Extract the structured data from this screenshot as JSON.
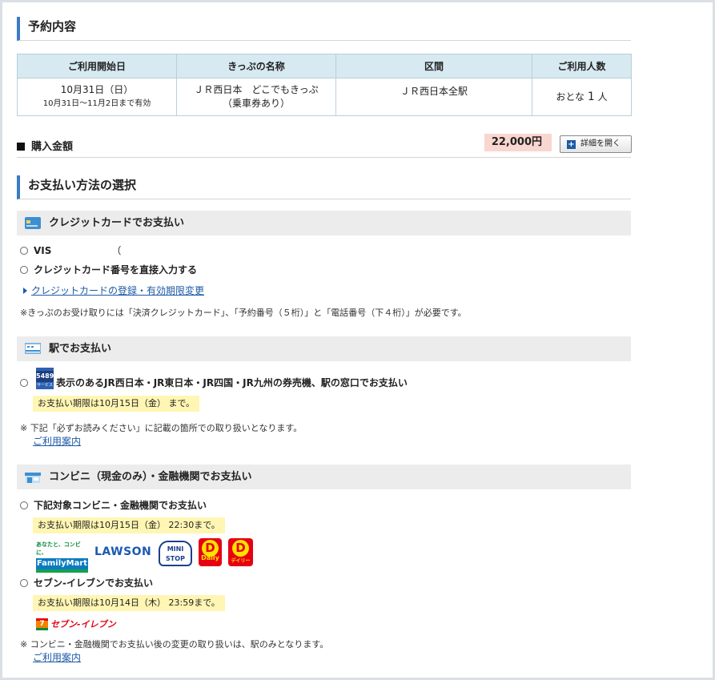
{
  "reservation": {
    "title": "予約内容",
    "headers": [
      "ご利用開始日",
      "きっぷの名称",
      "区間",
      "ご利用人数"
    ],
    "row": {
      "date": "10月31日（日）",
      "date_range": "10月31日～11月2日まで有効",
      "ticket_name": "ＪＲ西日本　どこでもきっぷ",
      "ticket_sub": "（乗車券あり）",
      "section": "ＪＲ西日本全駅",
      "people_prefix": "おとな",
      "people_count": "1",
      "people_suffix": "人"
    }
  },
  "purchase": {
    "label": "購入金額",
    "price": "22,000円",
    "detail_button": "詳細を開く",
    "detail_icon": "+"
  },
  "payment": {
    "title": "お支払い方法の選択",
    "credit": {
      "band": "クレジットカードでお支払い",
      "option1": "VIS",
      "option1_tail": "（",
      "option2": "クレジットカード番号を直接入力する",
      "link": "クレジットカードの登録・有効期限変更",
      "note": "※きっぷのお受け取りには「決済クレジットカード」、「予約番号（５桁）」と「電話番号（下４桁）」が必要です。"
    },
    "station": {
      "band": "駅でお支払い",
      "badge": "5489",
      "badge_sub": "サービス",
      "option": "表示のあるJR西日本・JR東日本・JR四国・JR九州の券売機、駅の窓口でお支払い",
      "deadline": "お支払い期限は10月15日（金） まで。",
      "note": "※ 下記「必ずお読みください」に記載の箇所での取り扱いとなります。",
      "link": "ご利用案内"
    },
    "conv": {
      "band": "コンビニ（現金のみ）・金融機関でお支払い",
      "option1": "下記対象コンビニ・金融機関でお支払い",
      "deadline1": "お支払い期限は10月15日（金） 22:30まで。",
      "logos": {
        "familymart_top": "あなたと、コンビに、",
        "familymart": "FamilyMart",
        "lawson": "LAWSON",
        "ministop": "MINI STOP",
        "daily": "Daily",
        "daily2": "デイリー"
      },
      "option2": "セブン-イレブンでお支払い",
      "deadline2": "お支払い期限は10月14日（木） 23:59まで。",
      "seven": "セブン-イレブン",
      "note": "※ コンビニ・金融機関でお支払い後の変更の取り扱いは、駅のみとなります。",
      "link": "ご利用案内"
    }
  },
  "colors": {
    "accent": "#3a7cc2",
    "table_header": "#d7eaf1",
    "price_bg": "#f9d6cf",
    "highlight": "#fff6b3",
    "link": "#1d5aa6"
  }
}
